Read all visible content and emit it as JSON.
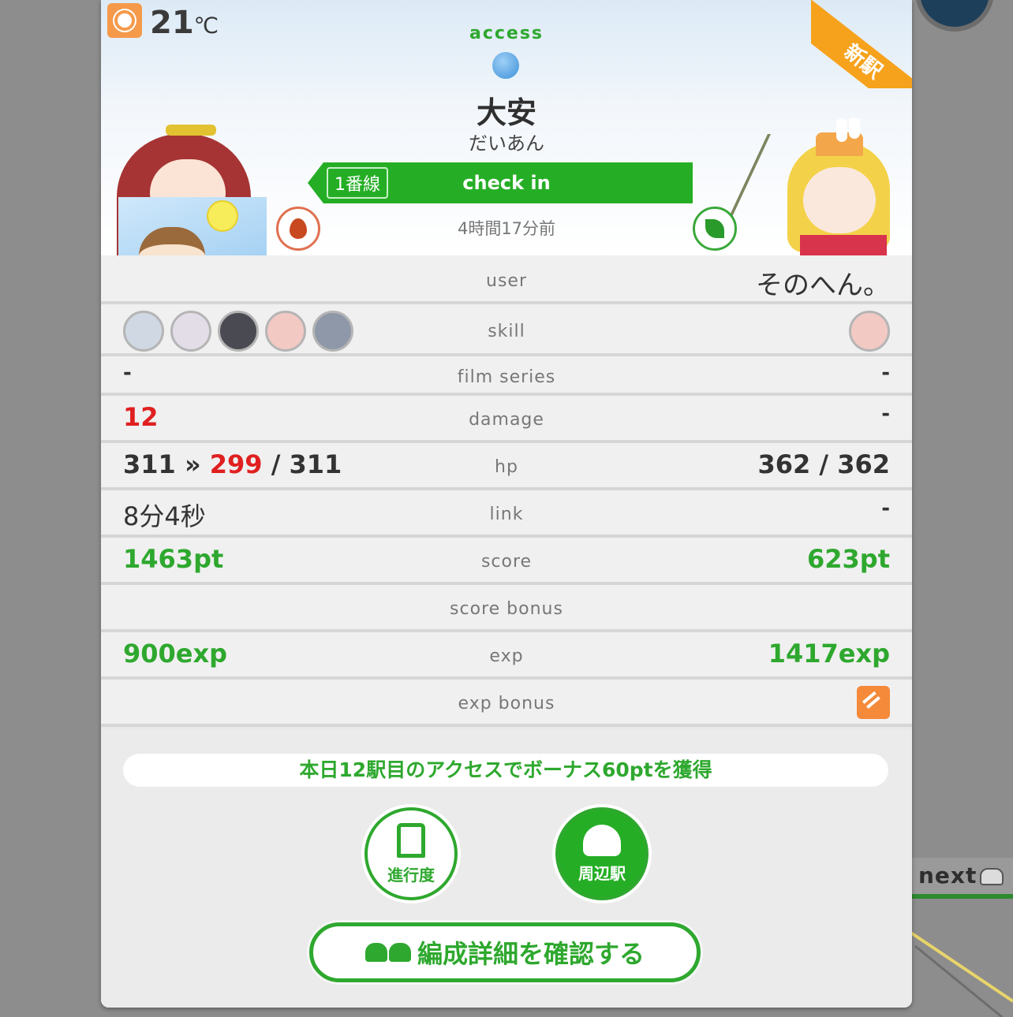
{
  "weather": {
    "icon": "sun-icon",
    "temperature": "21",
    "unit": "℃"
  },
  "badge": {
    "new_station": "新駅"
  },
  "station": {
    "access_label": "access",
    "attribute_icon": "water-drop-icon",
    "name": "大安",
    "kana": "だいあん",
    "line_badge": "1番線",
    "checkin_label": "check in",
    "time_ago": "4時間17分前"
  },
  "rows": {
    "user": {
      "label": "user",
      "right": "そのへん。"
    },
    "skill": {
      "label": "skill"
    },
    "film": {
      "label": "film series",
      "left": "-",
      "right": "-"
    },
    "damage": {
      "label": "damage",
      "left": "12",
      "right": "-"
    },
    "hp": {
      "label": "hp",
      "left_before": "311 »",
      "left_after": "299",
      "left_max": "/ 311",
      "right": "362 / 362"
    },
    "link": {
      "label": "link",
      "left": "8分4秒",
      "right": "-"
    },
    "score": {
      "label": "score",
      "left": "1463pt",
      "right": "623pt"
    },
    "score_bonus": {
      "label": "score bonus"
    },
    "exp": {
      "label": "exp",
      "left": "900exp",
      "right": "1417exp"
    },
    "exp_bonus": {
      "label": "exp bonus"
    }
  },
  "footer": {
    "notice": "本日12駅目のアクセスでボーナス60ptを獲得",
    "progress_label": "進行度",
    "nearby_label": "周辺駅",
    "formation_label": "編成詳細を確認する"
  },
  "background": {
    "next_label": "next"
  },
  "colors": {
    "accent_green": "#2ea82e",
    "damage_red": "#e02020",
    "ribbon_orange": "#f7a21c"
  }
}
